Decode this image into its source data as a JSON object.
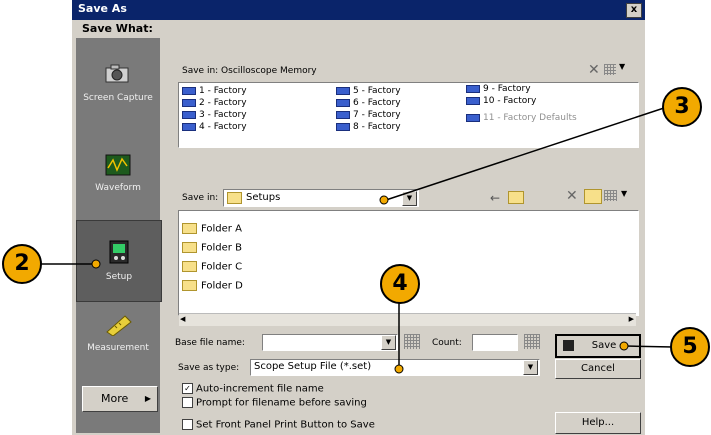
{
  "dialog": {
    "title": "Save As",
    "close_glyph": "x"
  },
  "sidebar": {
    "heading": "Save What:",
    "items": [
      {
        "label": "Screen Capture",
        "icon": "camera-icon"
      },
      {
        "label": "Waveform",
        "icon": "waveform-icon"
      },
      {
        "label": "Setup",
        "icon": "setup-icon",
        "selected": true
      },
      {
        "label": "Measurement",
        "icon": "ruler-icon"
      }
    ],
    "more_label": "More"
  },
  "memory": {
    "heading": "Save in: Oscilloscope Memory",
    "items": [
      "1 - Factory",
      "2 - Factory",
      "3 - Factory",
      "4 - Factory",
      "5 - Factory",
      "6 - Factory",
      "7 - Factory",
      "8 - Factory",
      "9 - Factory",
      "10 - Factory",
      "11 - Factory Defaults"
    ]
  },
  "save_in": {
    "label": "Save in:",
    "value": "Setups"
  },
  "folders": [
    "Folder A",
    "Folder B",
    "Folder C",
    "Folder D"
  ],
  "base_file": {
    "label": "Base file name:",
    "value": "",
    "count_label": "Count:",
    "count_value": ""
  },
  "save_type": {
    "label": "Save as type:",
    "value": "Scope Setup File (*.set)"
  },
  "options": [
    {
      "label": "Auto-increment file name",
      "checked": true
    },
    {
      "label": "Prompt for filename before saving",
      "checked": false
    },
    {
      "label": "Set Front Panel Print Button to Save",
      "checked": false
    }
  ],
  "buttons": {
    "save": "Save",
    "cancel": "Cancel",
    "help": "Help..."
  },
  "callouts": [
    "2",
    "3",
    "4",
    "5"
  ],
  "colors": {
    "titlebar": "#0a246a",
    "callout": "#f2a900",
    "sidebar": "#7a7a7a"
  }
}
